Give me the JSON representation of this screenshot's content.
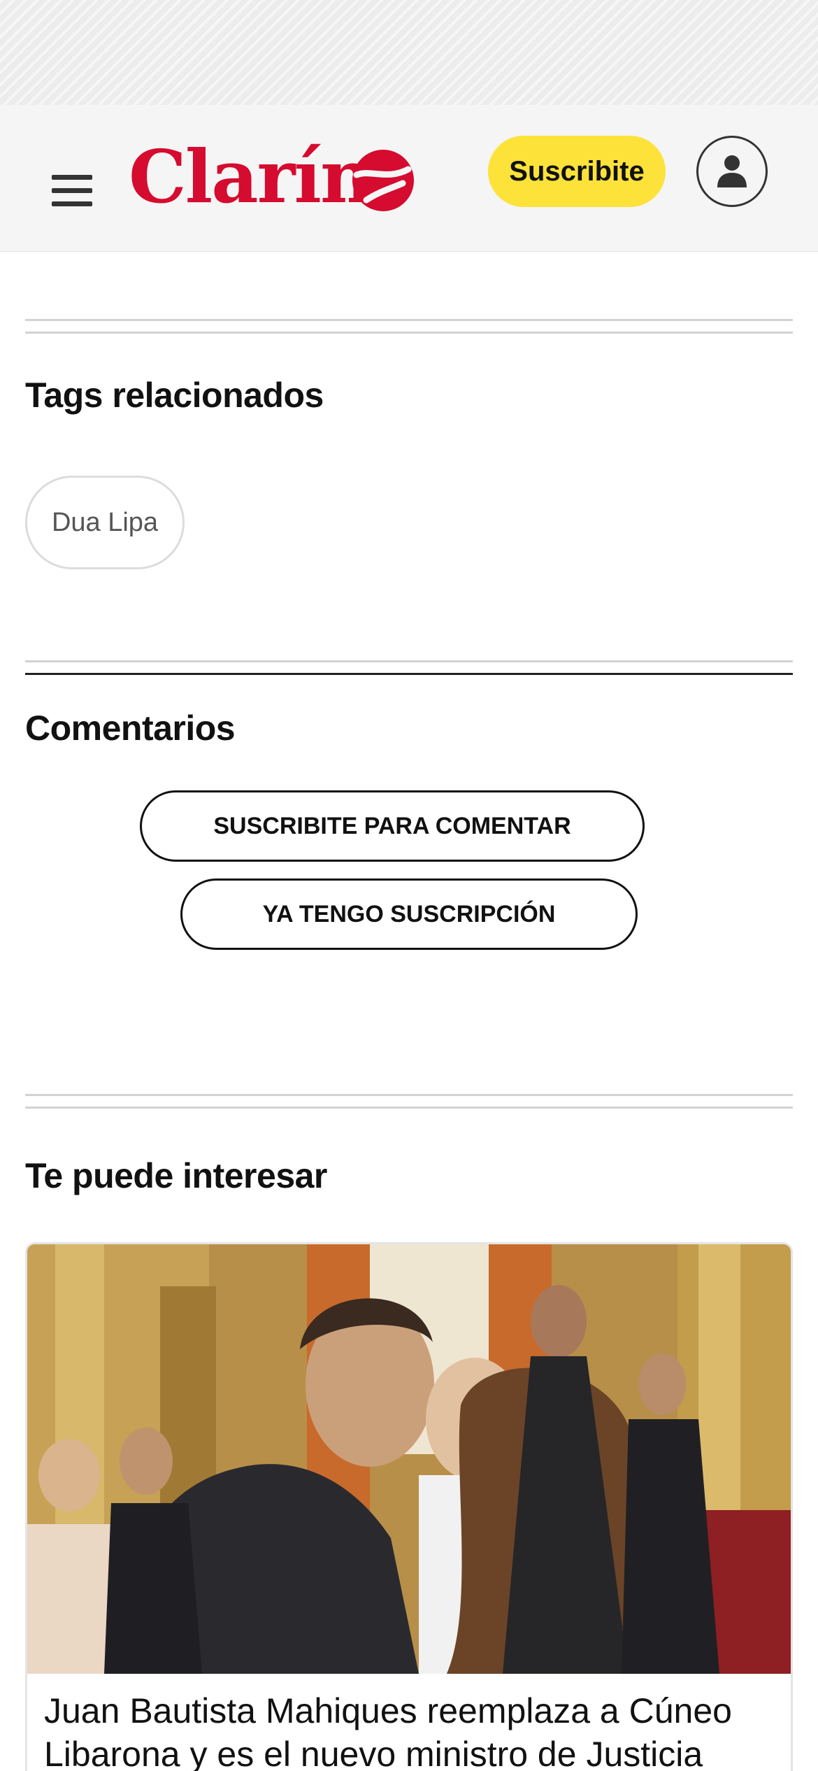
{
  "header": {
    "logo_text": "Clarín",
    "subscribe_label": "Suscribite",
    "brand_color": "#d50b2f",
    "accent_color": "#fde23a",
    "icons": [
      "hamburger-menu-icon",
      "clarin-logo-mark-icon",
      "user-icon"
    ]
  },
  "tags": {
    "title": "Tags relacionados",
    "items": [
      {
        "label": "Dua Lipa"
      }
    ]
  },
  "comments": {
    "title": "Comentarios",
    "subscribe_to_comment_label": "SUSCRIBITE PARA COMENTAR",
    "already_subscribed_label": "YA TENGO SUSCRIPCIÓN"
  },
  "recommended": {
    "title": "Te puede interesar",
    "articles": [
      {
        "headline": "Juan Bautista Mahiques reemplaza a Cúneo Libarona y es el nuevo ministro de Justicia"
      }
    ]
  }
}
